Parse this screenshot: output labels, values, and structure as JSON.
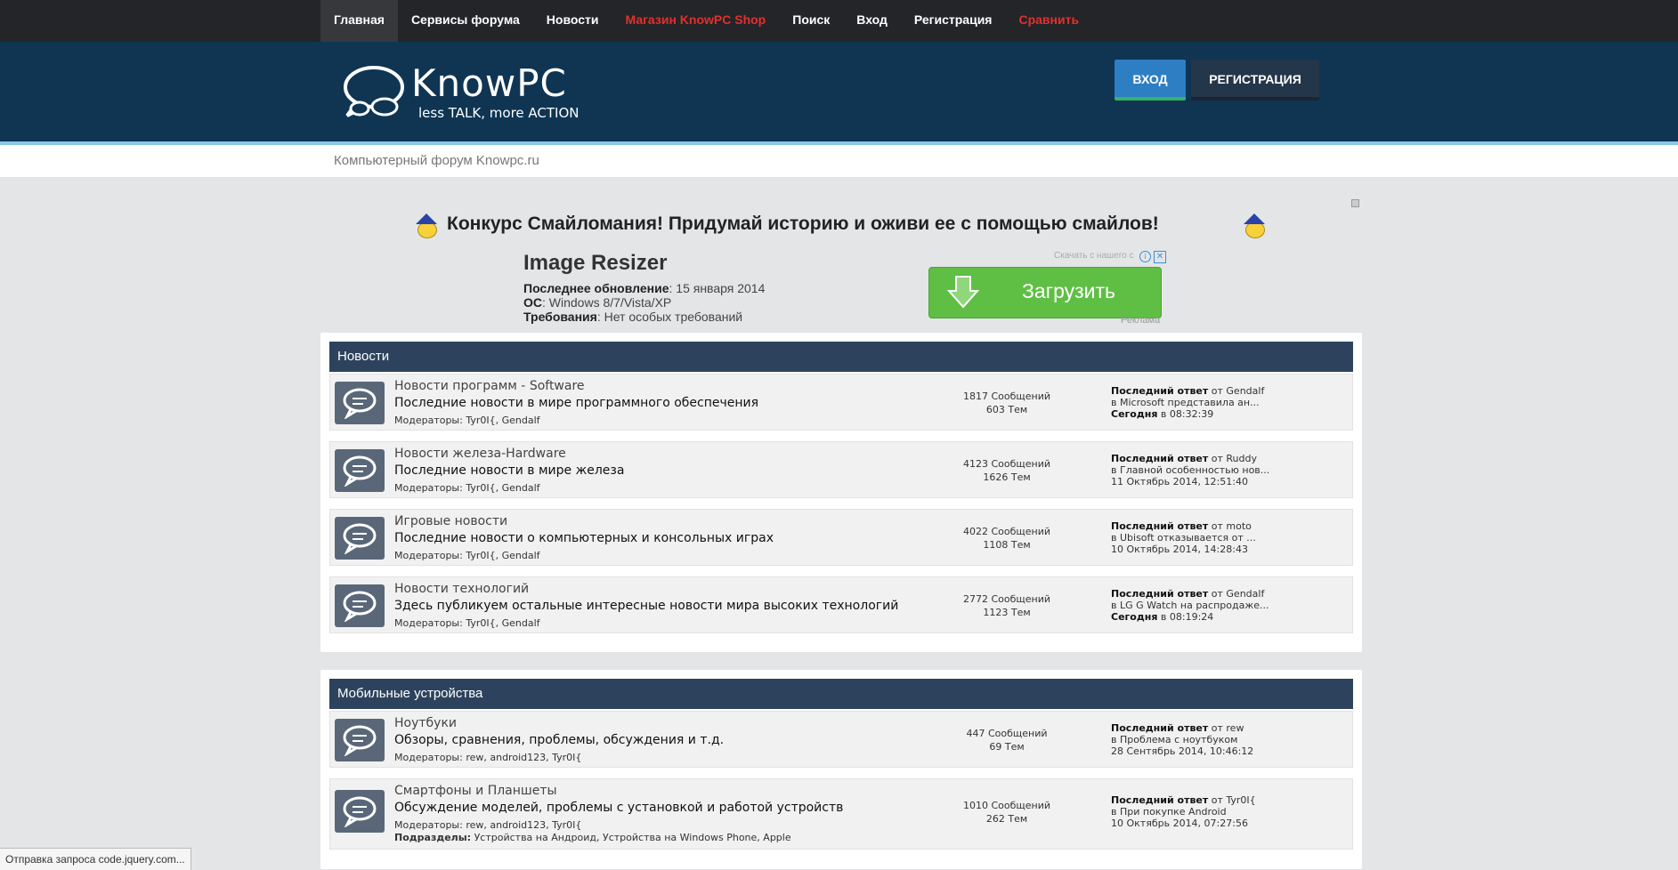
{
  "nav": {
    "items": [
      {
        "label": "Главная"
      },
      {
        "label": "Сервисы форума"
      },
      {
        "label": "Новости"
      },
      {
        "label": "Магазин KnowPC Shop"
      },
      {
        "label": "Поиск"
      },
      {
        "label": "Вход"
      },
      {
        "label": "Регистрация"
      },
      {
        "label": "Сравнить"
      }
    ]
  },
  "header": {
    "brand": "KnowPC",
    "tagline": "less TALK, more ACTION",
    "login_label": "ВХОД",
    "register_label": "РЕГИСТРАЦИЯ"
  },
  "breadcrumb": "Компьютерный форум Knowpc.ru",
  "banner": "Конкурс Смайломания! Придумай историю и оживи ее с помощью смайлов!",
  "ad": {
    "title": "Image Resizer",
    "updated_label": "Последнее обновление",
    "updated_value": ": 15 января 2014",
    "os_label": "ОС",
    "os_value": ":   Windows 8/7/Vista/XP",
    "req_label": "Требования",
    "req_value": ": Нет особых требований",
    "download_label": "Загрузить",
    "from_label": "Скачать с нашего с",
    "ad_label": "Реклама"
  },
  "categories": [
    {
      "title": "Новости",
      "forums": [
        {
          "name": "Новости программ - Software",
          "desc": "Последние новости в мире программного обеспечения",
          "mods": "Модераторы: Tyr0I{, Gendalf",
          "posts": "1817 Сообщений",
          "topics": "603 Тем",
          "last_label": "Последний ответ",
          "last_by": " от Gendalf",
          "last_in": "в Microsoft представила ан...",
          "last_day": "Сегодня",
          "last_time": " в 08:32:39"
        },
        {
          "name": "Новости железа-Hardware",
          "desc": "Последние новости в мире железа",
          "mods": "Модераторы: Tyr0I{, Gendalf",
          "posts": "4123 Сообщений",
          "topics": "1626 Тем",
          "last_label": "Последний ответ",
          "last_by": " от Ruddy",
          "last_in": "в Главной особенностью нов...",
          "last_day": "",
          "last_time": "11 Октябрь 2014, 12:51:40"
        },
        {
          "name": "Игровые новости",
          "desc": "Последние новости о компьютерных и консольных играх",
          "mods": "Модераторы: Tyr0I{, Gendalf",
          "posts": "4022 Сообщений",
          "topics": "1108 Тем",
          "last_label": "Последний ответ",
          "last_by": " от moto",
          "last_in": "в Ubisoft отказывается от ...",
          "last_day": "",
          "last_time": "10 Октябрь 2014, 14:28:43"
        },
        {
          "name": "Новости технологий",
          "desc": "Здесь публикуем остальные интересные новости мира высоких технологий",
          "mods": "Модераторы: Tyr0I{, Gendalf",
          "posts": "2772 Сообщений",
          "topics": "1123 Тем",
          "last_label": "Последний ответ",
          "last_by": " от Gendalf",
          "last_in": "в LG G Watch на распродаже...",
          "last_day": "Сегодня",
          "last_time": " в 08:19:24"
        }
      ]
    },
    {
      "title": "Мобильные устройства",
      "forums": [
        {
          "name": "Ноутбуки",
          "desc": "Обзоры, сравнения, проблемы, обсуждения и т.д.",
          "mods": "Модераторы: rew, android123, Tyr0I{",
          "posts": "447 Сообщений",
          "topics": "69 Тем",
          "last_label": "Последний ответ",
          "last_by": " от rew",
          "last_in": "в Проблема с ноутбуком",
          "last_day": "",
          "last_time": "28 Сентябрь 2014, 10:46:12"
        },
        {
          "name": "Смартфоны и Планшеты",
          "desc": "Обсуждение моделей, проблемы с установкой и работой устройств",
          "mods": "Модераторы: rew, android123, Tyr0I{",
          "sub_label": "Подразделы:",
          "sub_value": " Устройства на Андроид, Устройства на Windows Phone, Apple",
          "posts": "1010 Сообщений",
          "topics": "262 Тем",
          "last_label": "Последний ответ",
          "last_by": " от Tyr0I{",
          "last_in": "в При покупке Android",
          "last_day": "",
          "last_time": "10 Октябрь 2014, 07:27:56"
        }
      ]
    }
  ],
  "statusbar": "Отправка запроса code.jquery.com..."
}
